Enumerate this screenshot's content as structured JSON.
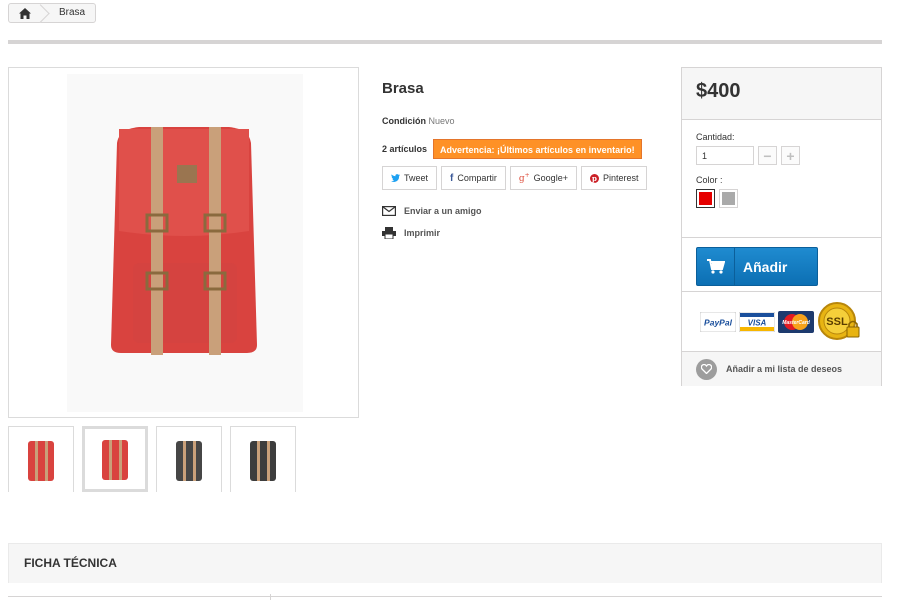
{
  "breadcrumb": {
    "home_icon": "home-icon",
    "current": "Brasa"
  },
  "product": {
    "title": "Brasa",
    "condition_label": "Condición",
    "condition_value": "Nuevo",
    "stock_count": "2 artículos",
    "stock_warning": "Advertencia: ¡Últimos artículos en inventario!",
    "main_image_color": "#d84c46",
    "thumbnails": [
      {
        "color": "#d84c46",
        "icon": "backpack-red-thumb",
        "active": false
      },
      {
        "color": "#d84c46",
        "icon": "backpack-red-thumb",
        "active": true
      },
      {
        "color": "#464646",
        "icon": "backpack-dark-thumb",
        "active": false
      },
      {
        "color": "#3d3d3d",
        "icon": "backpack-dark-thumb",
        "active": false
      }
    ]
  },
  "social": {
    "tweet": "Tweet",
    "share": "Compartir",
    "googleplus": "Google+",
    "pinterest": "Pinterest"
  },
  "actions": {
    "send_friend": "Enviar a un amigo",
    "print": "Imprimir"
  },
  "buybox": {
    "price": "$400",
    "quantity_label": "Cantidad:",
    "quantity_value": "1",
    "color_label": "Color :",
    "colors": [
      "#e60000",
      "#aaaaaa"
    ],
    "selected_color": "#e60000",
    "add_to_cart": "Añadir",
    "payment_logos": [
      "PayPal",
      "VISA",
      "MasterCard",
      "SSL"
    ],
    "wishlist": "Añadir a mi lista de deseos"
  },
  "tabs": {
    "datasheet": "Ficha técnica"
  },
  "colors": {
    "accent_blue": "#0c6fb3",
    "warning_orange": "#fe9126"
  }
}
